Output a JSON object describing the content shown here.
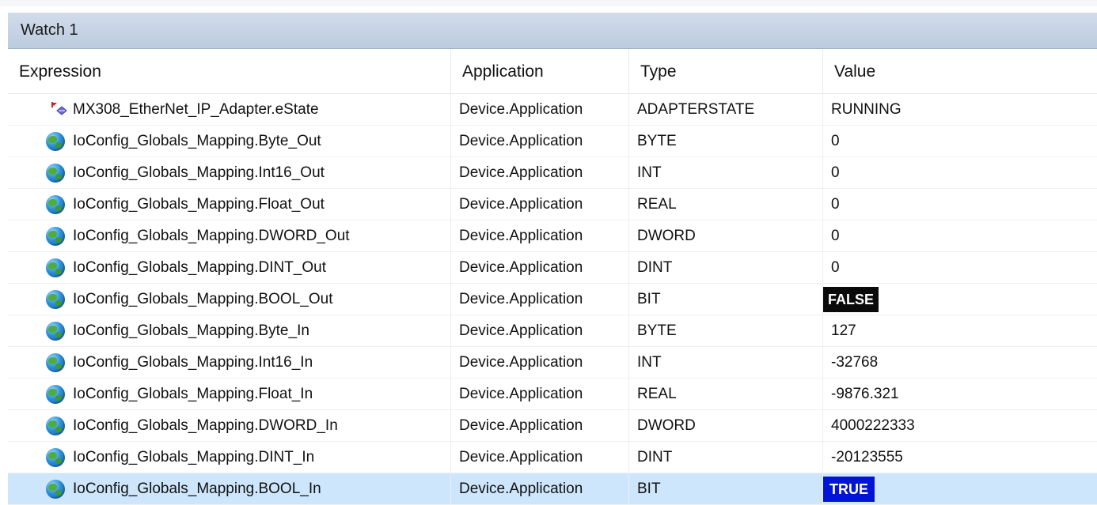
{
  "window": {
    "title": "Watch 1"
  },
  "columns": {
    "expression": "Expression",
    "application": "Application",
    "type": "Type",
    "value": "Value"
  },
  "rows": [
    {
      "expression": "MX308_EtherNet_IP_Adapter.eState",
      "application": "Device.Application",
      "type": "ADAPTERSTATE",
      "value": "RUNNING",
      "icon": "enum-variable-icon"
    },
    {
      "expression": "IoConfig_Globals_Mapping.Byte_Out",
      "application": "Device.Application",
      "type": "BYTE",
      "value": "0",
      "icon": "globe-icon"
    },
    {
      "expression": "IoConfig_Globals_Mapping.Int16_Out",
      "application": "Device.Application",
      "type": "INT",
      "value": "0",
      "icon": "globe-icon"
    },
    {
      "expression": "IoConfig_Globals_Mapping.Float_Out",
      "application": "Device.Application",
      "type": "REAL",
      "value": "0",
      "icon": "globe-icon"
    },
    {
      "expression": "IoConfig_Globals_Mapping.DWORD_Out",
      "application": "Device.Application",
      "type": "DWORD",
      "value": "0",
      "icon": "globe-icon"
    },
    {
      "expression": "IoConfig_Globals_Mapping.DINT_Out",
      "application": "Device.Application",
      "type": "DINT",
      "value": "0",
      "icon": "globe-icon"
    },
    {
      "expression": "IoConfig_Globals_Mapping.BOOL_Out",
      "application": "Device.Application",
      "type": "BIT",
      "value": "FALSE",
      "icon": "globe-icon"
    },
    {
      "expression": "IoConfig_Globals_Mapping.Byte_In",
      "application": "Device.Application",
      "type": "BYTE",
      "value": "127",
      "icon": "globe-icon"
    },
    {
      "expression": "IoConfig_Globals_Mapping.Int16_In",
      "application": "Device.Application",
      "type": "INT",
      "value": "-32768",
      "icon": "globe-icon"
    },
    {
      "expression": "IoConfig_Globals_Mapping.Float_In",
      "application": "Device.Application",
      "type": "REAL",
      "value": "-9876.321",
      "icon": "globe-icon"
    },
    {
      "expression": "IoConfig_Globals_Mapping.DWORD_In",
      "application": "Device.Application",
      "type": "DWORD",
      "value": "4000222333",
      "icon": "globe-icon"
    },
    {
      "expression": "IoConfig_Globals_Mapping.DINT_In",
      "application": "Device.Application",
      "type": "DINT",
      "value": "-20123555",
      "icon": "globe-icon"
    },
    {
      "expression": "IoConfig_Globals_Mapping.BOOL_In",
      "application": "Device.Application",
      "type": "BIT",
      "value": "TRUE",
      "icon": "globe-icon"
    }
  ],
  "colors": {
    "titlebar": "#c9d5e6",
    "selected_row": "#cde6fb",
    "false_badge": "#0a0a0a",
    "true_badge": "#0014d6"
  }
}
